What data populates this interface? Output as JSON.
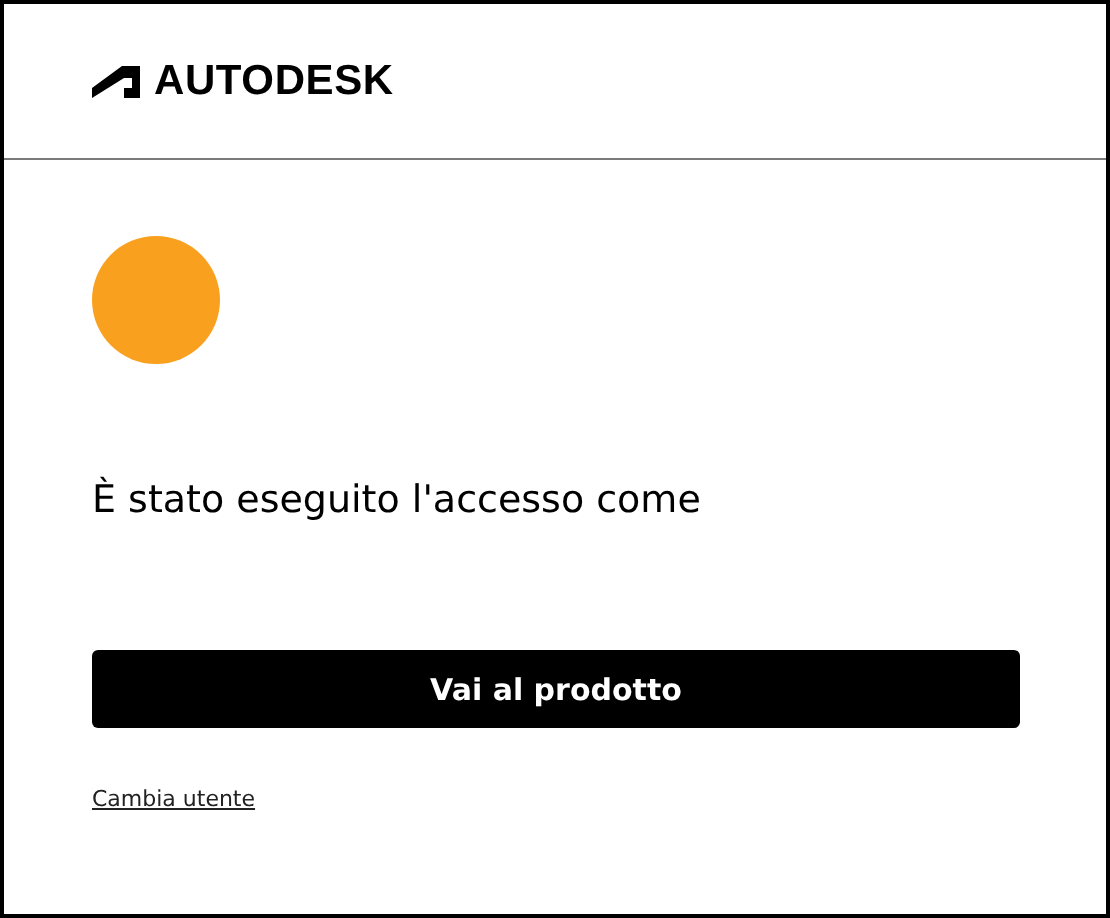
{
  "header": {
    "logo_text": "AUTODESK"
  },
  "message": "È stato eseguito l'accesso come",
  "primary_button": "Vai al prodotto",
  "switch_user_link": "Cambia utente"
}
